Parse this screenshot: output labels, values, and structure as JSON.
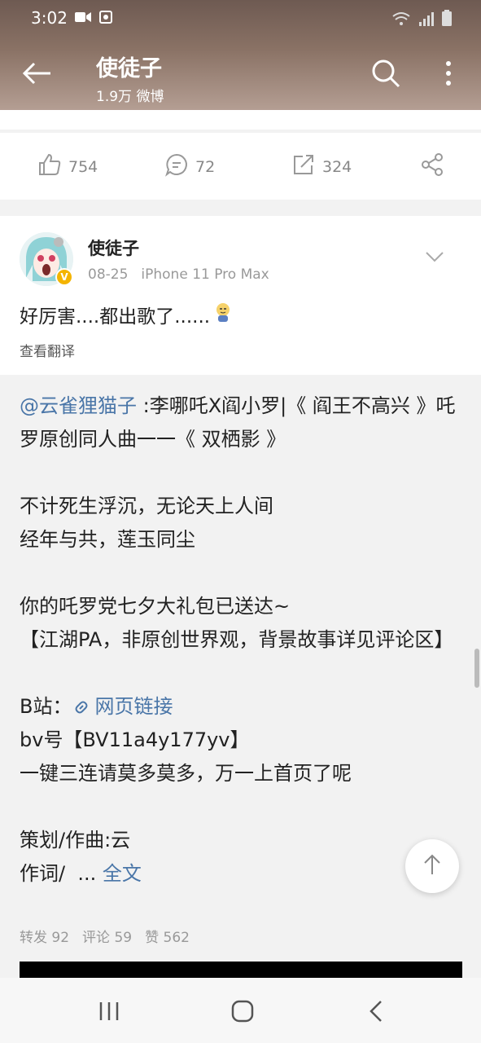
{
  "status_bar": {
    "time": "3:02"
  },
  "header": {
    "title": "使徒子",
    "subtitle": "1.9万 微博"
  },
  "action_bar": {
    "like_count": "754",
    "comment_count": "72",
    "repost_count": "324"
  },
  "post": {
    "username": "使徒子",
    "date": "08-25",
    "device": "iPhone 11 Pro Max",
    "text": "好厉害....都出歌了......",
    "translate_label": "查看翻译"
  },
  "repost": {
    "mention": "@云雀狸猫子",
    "line1": " :李哪吒X阎小罗|《 阎王不高兴 》吒罗原创同人曲一一《 双栖影 》",
    "line2": "不计死生浮沉，无论天上人间",
    "line3": "经年与共，莲玉同尘",
    "line4": "你的吒罗党七夕大礼包已送达~",
    "line5": "【江湖PA，非原创世界观，背景故事详见评论区】",
    "bili_label": "B站：",
    "link_text": "网页链接",
    "line6": "bv号【BV11a4y177yv】",
    "line7": "一键三连请莫多莫多，万一上首页了呢",
    "line8": "策划/作曲:云",
    "line9_prefix": "作词/  ... ",
    "full_text": "全文",
    "stats": {
      "forward": "转发 92",
      "comments": "评论 59",
      "likes": "赞 562"
    }
  },
  "colors": {
    "link": "#4a76a8",
    "verified": "#f4b400"
  }
}
